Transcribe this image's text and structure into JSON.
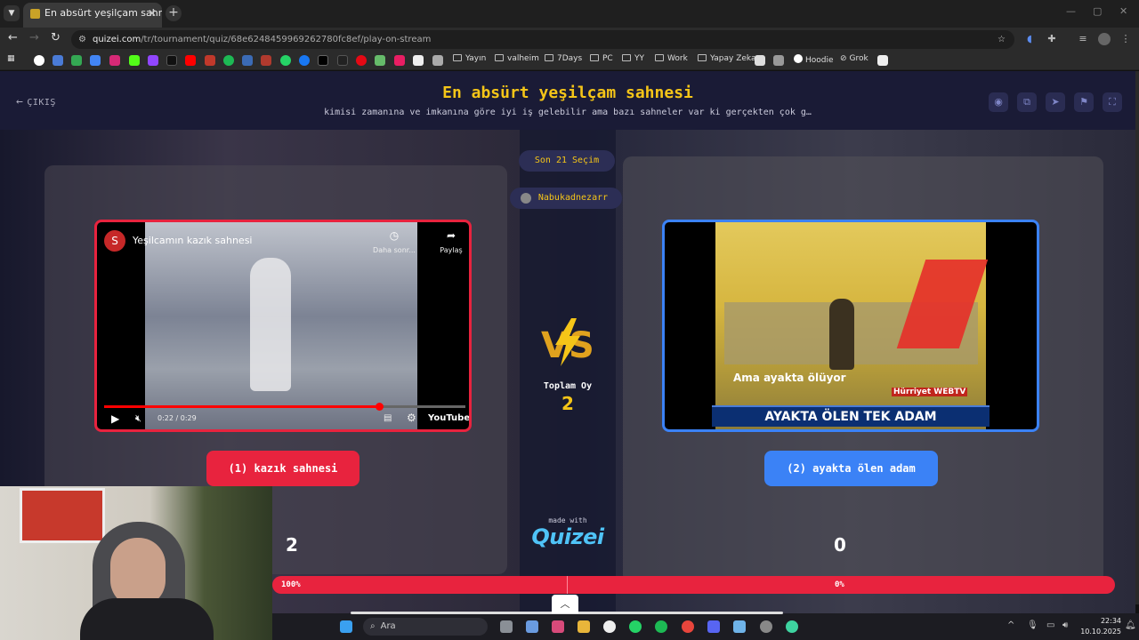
{
  "browser": {
    "tab_title": "En absürt yeşilçam sahnesi - Q",
    "url_host": "quizei.com",
    "url_path": "/tr/tournament/quiz/68e6248459969262780fc8ef/play-on-stream",
    "bookmark_folders": [
      "Yayın",
      "valheim",
      "7Days",
      "PC",
      "YY",
      "Work",
      "Yapay Zeka"
    ],
    "bookmark_links": [
      "Hoodie",
      "Grok"
    ]
  },
  "page": {
    "exit_label": "ÇIKIŞ",
    "title": "En absürt yeşilçam sahnesi",
    "subtitle": "kimisi zamanına ve imkanına göre iyi iş gelebilir ama bazı sahneler var ki gerçekten çok g…",
    "last_choices": "Son 21 Seçim",
    "streamer": "Nabukadnezarr",
    "total_votes_label": "Toplam Oy",
    "total_votes": "2",
    "made_with": "made with",
    "brand": "Quizei"
  },
  "left": {
    "video_title": "Yeşilcamın kazık sahnesi",
    "channel_initial": "S",
    "later_label": "Daha sonr...",
    "share_label": "Paylaş",
    "time": "0:22 / 0:29",
    "youtube": "YouTube",
    "progress": 0.76,
    "choice_label": "(1) kazık sahnesi",
    "score": "2",
    "percent": "100%"
  },
  "right": {
    "caption_small": "Ama ayakta ölüyor",
    "caption_big": "AYAKTA ÖLEN TEK ADAM",
    "watermark": "Hürriyet WEBTV",
    "choice_label": "(2) ayakta ölen adam",
    "score": "0",
    "percent": "0%"
  },
  "taskbar": {
    "search": "Ara",
    "time": "22:34",
    "date": "10.10.2025"
  },
  "colors": {
    "red": "#e8233e",
    "blue": "#3b82f6",
    "gold": "#f5c518"
  }
}
